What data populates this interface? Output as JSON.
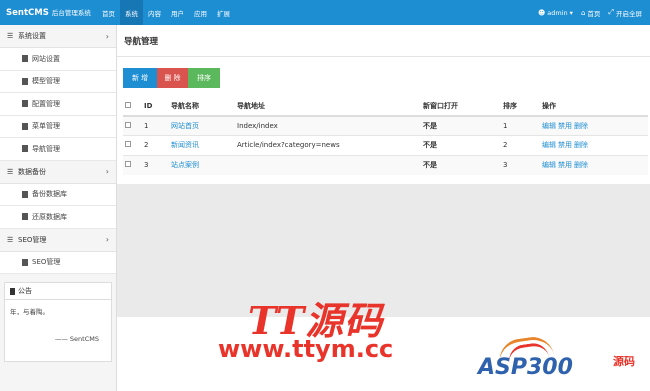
{
  "header": {
    "brand_name": "SentCMS",
    "brand_sub": "后台管理系统",
    "nav": [
      "首页",
      "系统",
      "内容",
      "用户",
      "应用",
      "扩展"
    ],
    "active_nav": "系统",
    "user": "admin",
    "home": "首页",
    "fullscreen": "开启全屏"
  },
  "sidebar": {
    "groups": [
      {
        "label": "系统设置",
        "items": [
          "网站设置",
          "模型管理",
          "配置管理",
          "菜单管理",
          "导航管理"
        ]
      },
      {
        "label": "数据备份",
        "items": [
          "备份数据库",
          "还原数据库"
        ]
      },
      {
        "label": "SEO管理",
        "items": [
          "SEO管理"
        ]
      }
    ],
    "notice": {
      "title": "公告",
      "body": "年，与着陶。",
      "signature": "—— SentCMS"
    }
  },
  "main": {
    "title": "导航管理",
    "buttons": {
      "add": "新 增",
      "delete": "删 除",
      "sort": "排序"
    },
    "table": {
      "headers": [
        "ID",
        "导航名称",
        "导航地址",
        "新窗口打开",
        "排序",
        "操作"
      ],
      "rows": [
        {
          "id": "1",
          "name": "网站首页",
          "url": "Index/index",
          "new_window": "不是",
          "sort": "1",
          "edit": "编辑",
          "disable": "禁用",
          "remove": "删除"
        },
        {
          "id": "2",
          "name": "新闻资讯",
          "url": "Article/index?category=news",
          "new_window": "不是",
          "sort": "2",
          "edit": "编辑",
          "disable": "禁用",
          "remove": "删除"
        },
        {
          "id": "3",
          "name": "站点案例",
          "url": "",
          "new_window": "不是",
          "sort": "3",
          "edit": "编辑",
          "disable": "禁用",
          "remove": "删除"
        }
      ]
    }
  },
  "watermark": {
    "logo": "TT源码",
    "url": "www.ttym.cc",
    "asp": "ASP300",
    "asp_cn": "源码"
  },
  "colors": {
    "primary": "#1e8ed3",
    "danger": "#d9534f",
    "success": "#5cb85c",
    "watermark": "#e8342a"
  }
}
